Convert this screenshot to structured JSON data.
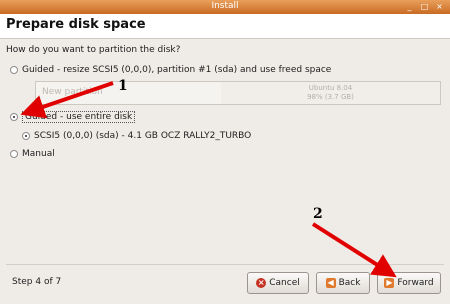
{
  "window": {
    "title": "Install",
    "controls": [
      "_",
      "□",
      "×"
    ]
  },
  "header": {
    "title": "Prepare disk space"
  },
  "question": "How do you want to partition the disk?",
  "options": [
    {
      "label": "Guided - resize SCSI5 (0,0,0), partition #1 (sda) and use freed space",
      "selected": false
    },
    {
      "label": "Guided - use entire disk",
      "selected": true
    },
    {
      "label": "Manual",
      "selected": false
    }
  ],
  "partition_preview": {
    "new_label": "New partition",
    "ubuntu_line1": "Ubuntu 8.04",
    "ubuntu_line2": "98% (3.7 GB)"
  },
  "disk": {
    "label": "SCSI5 (0,0,0) (sda) - 4.1 GB OCZ RALLY2_TURBO",
    "selected": true
  },
  "footer": {
    "step": "Step 4 of 7",
    "cancel": "Cancel",
    "back": "Back",
    "forward": "Forward"
  },
  "annotations": {
    "one": "1",
    "two": "2",
    "color": "#e00000"
  }
}
